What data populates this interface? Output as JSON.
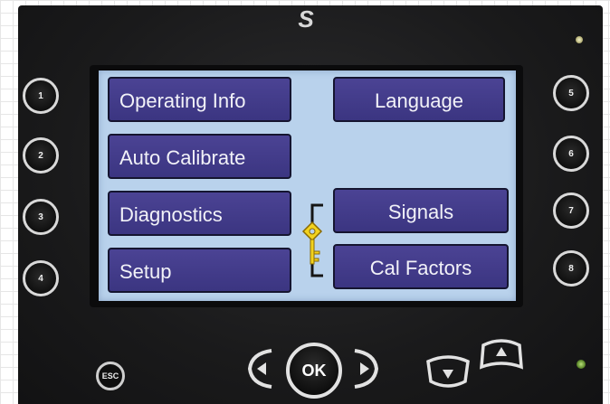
{
  "panel": {
    "brand_glyph": "S",
    "screen": {
      "menu": [
        {
          "id": "operating-info",
          "label": "Operating Info"
        },
        {
          "id": "auto-calibrate",
          "label": "Auto Calibrate"
        },
        {
          "id": "diagnostics",
          "label": "Diagnostics"
        },
        {
          "id": "setup",
          "label": "Setup"
        },
        {
          "id": "language",
          "label": "Language"
        },
        {
          "id": "signals",
          "label": "Signals"
        },
        {
          "id": "cal-factors",
          "label": "Cal Factors"
        }
      ],
      "lock_icon": "key-icon"
    },
    "keys_left": [
      "1",
      "2",
      "3",
      "4"
    ],
    "keys_right": [
      "5",
      "6",
      "7",
      "8"
    ],
    "nav": {
      "esc_label": "ESC",
      "ok_label": "OK",
      "icons": [
        "arrow-left-icon",
        "arrow-right-icon",
        "arrow-down-icon",
        "arrow-up-icon"
      ]
    }
  }
}
